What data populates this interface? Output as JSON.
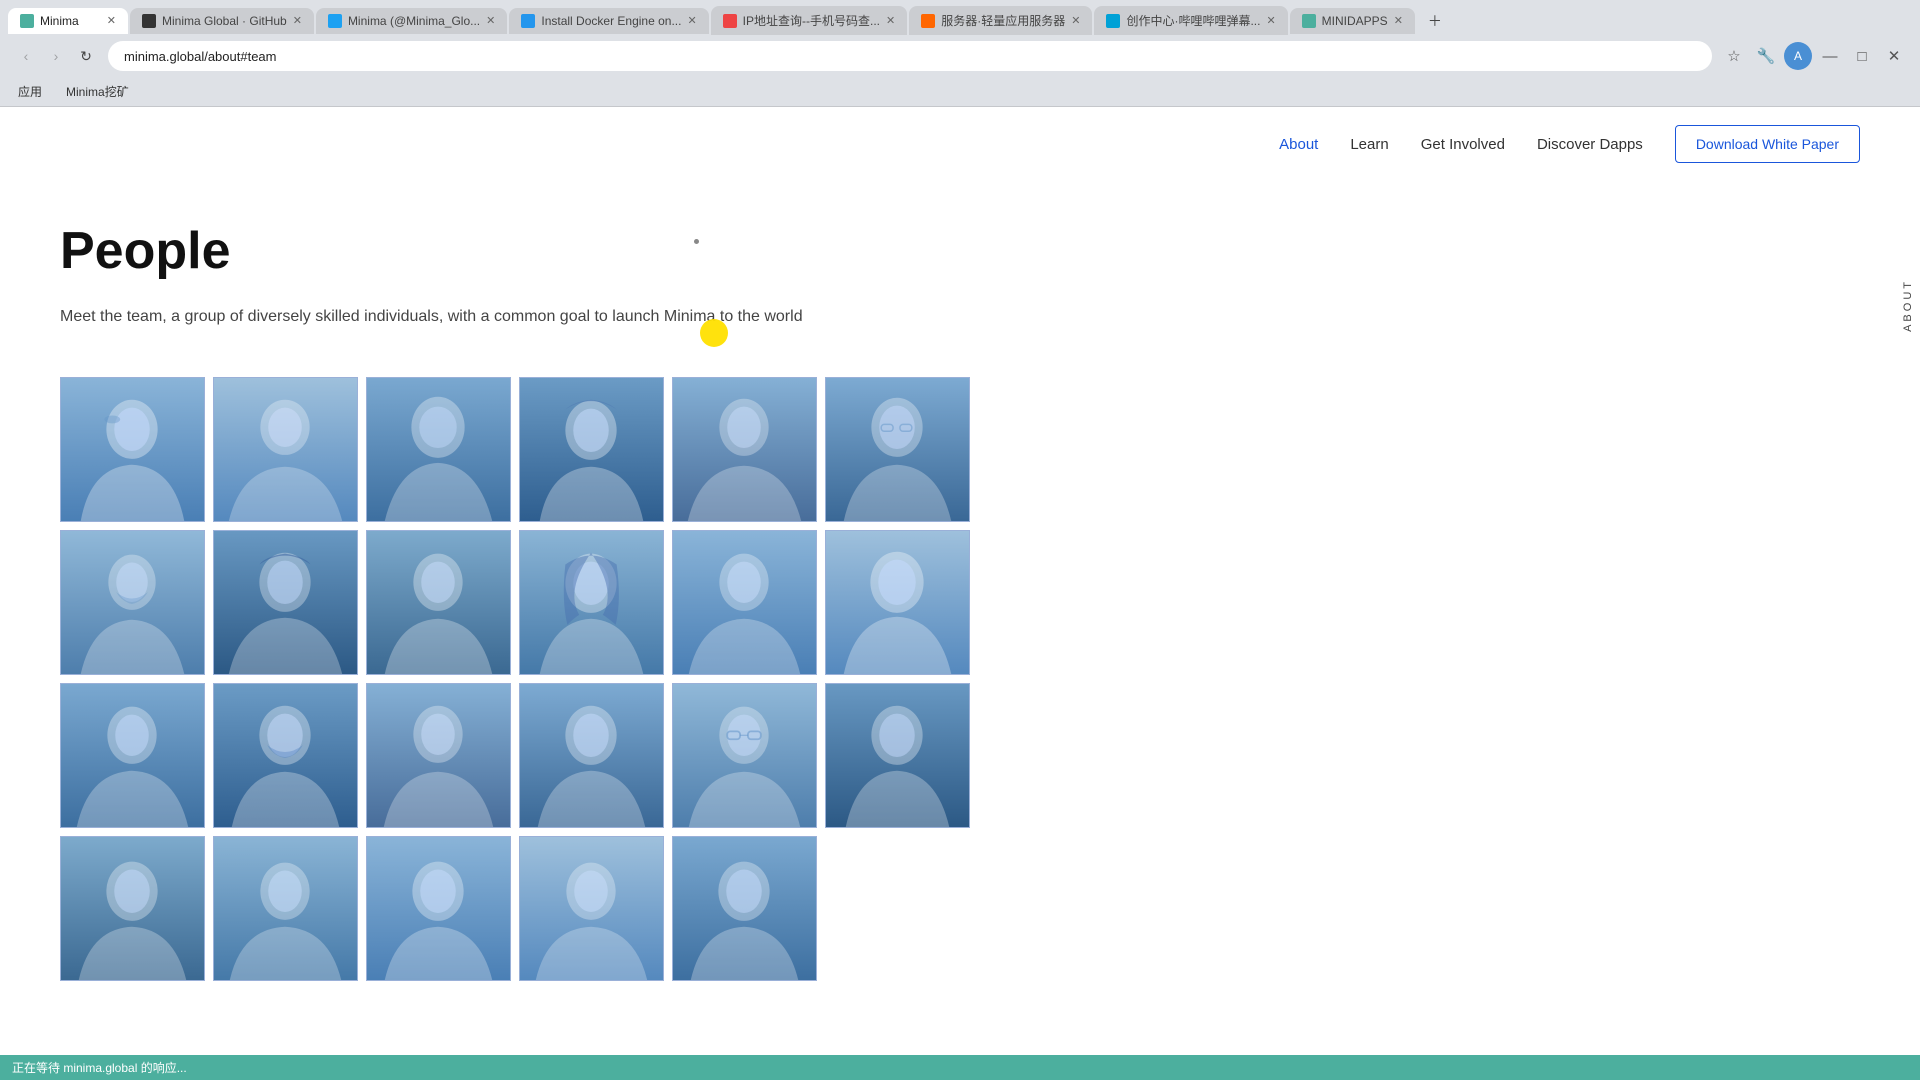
{
  "browser": {
    "tabs": [
      {
        "label": "Minima",
        "active": true,
        "favicon_color": "#4caf9e"
      },
      {
        "label": "Minima Global · GitHub",
        "active": false,
        "favicon_color": "#333"
      },
      {
        "label": "Minima (@Minima_Glo...",
        "active": false,
        "favicon_color": "#1da1f2"
      },
      {
        "label": "Install Docker Engine on...",
        "active": false,
        "favicon_color": "#2496ed"
      },
      {
        "label": "IP地址查询--手机号码查...",
        "active": false,
        "favicon_color": "#e44"
      },
      {
        "label": "服务器·轻量应用服务器",
        "active": false,
        "favicon_color": "#f60"
      },
      {
        "label": "创作中心·哔哩哔哩弹幕...",
        "active": false,
        "favicon_color": "#00a1d6"
      },
      {
        "label": "MINIDAPPS",
        "active": false,
        "favicon_color": "#4caf9e"
      }
    ],
    "address": "minima.global/about#team",
    "bookmarks": [
      {
        "label": "应用"
      },
      {
        "label": "Minima挖矿"
      }
    ]
  },
  "nav": {
    "links": [
      {
        "label": "About",
        "active": true
      },
      {
        "label": "Learn",
        "active": false
      },
      {
        "label": "Get Involved",
        "active": false
      },
      {
        "label": "Discover Dapps",
        "active": false
      }
    ],
    "download_btn": "Download White Paper"
  },
  "side_label": "ABOUT",
  "page": {
    "title": "People",
    "subtitle": "Meet the team, a group of diversely skilled individuals, with a common goal to launch Minima to the world"
  },
  "team": {
    "rows": [
      [
        {
          "id": 1,
          "style": "sil-1"
        },
        {
          "id": 2,
          "style": "sil-2"
        },
        {
          "id": 3,
          "style": "sil-3"
        },
        {
          "id": 4,
          "style": "sil-4"
        },
        {
          "id": 5,
          "style": "sil-5"
        },
        {
          "id": 6,
          "style": "sil-6"
        }
      ],
      [
        {
          "id": 7,
          "style": "sil-7"
        },
        {
          "id": 8,
          "style": "sil-8"
        },
        {
          "id": 9,
          "style": "sil-9"
        },
        {
          "id": 10,
          "style": "sil-10"
        },
        {
          "id": 11,
          "style": "sil-1"
        },
        {
          "id": 12,
          "style": "sil-2"
        }
      ],
      [
        {
          "id": 13,
          "style": "sil-3"
        },
        {
          "id": 14,
          "style": "sil-4"
        },
        {
          "id": 15,
          "style": "sil-5"
        },
        {
          "id": 16,
          "style": "sil-6"
        },
        {
          "id": 17,
          "style": "sil-7"
        },
        {
          "id": 18,
          "style": "sil-8"
        }
      ],
      [
        {
          "id": 19,
          "style": "sil-9"
        },
        {
          "id": 20,
          "style": "sil-10"
        },
        {
          "id": 21,
          "style": "sil-1"
        },
        {
          "id": 22,
          "style": "sil-2"
        },
        {
          "id": 23,
          "style": "sil-3"
        }
      ]
    ]
  },
  "status": {
    "text": "正在等待 minima.global 的响应..."
  }
}
